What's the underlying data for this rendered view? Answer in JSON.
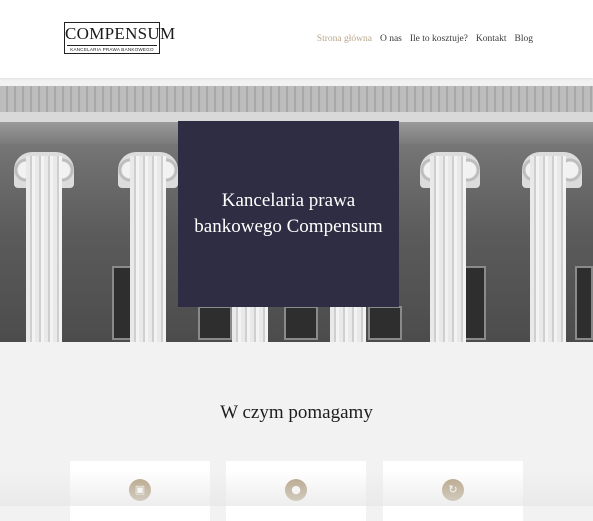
{
  "logo": {
    "name": "COMPENSUM",
    "subtitle": "KANCELARIA PRAWA BANKOWEGO"
  },
  "nav": {
    "items": [
      "Strona główna",
      "O nas",
      "Ile to kosztuje?",
      "Kontakt",
      "Blog"
    ],
    "active_index": 0,
    "active_color": "#b9a78b"
  },
  "hero": {
    "title": "Kancelaria prawa bankowego Compensum",
    "card_color": "#2f2d43"
  },
  "services": {
    "title": "W czym pomagamy",
    "cards": [
      {
        "icon": "piggy-bank-icon"
      },
      {
        "icon": "money-bag-icon"
      },
      {
        "icon": "refund-arrow-icon"
      }
    ],
    "icon_color": "#b3a081"
  }
}
